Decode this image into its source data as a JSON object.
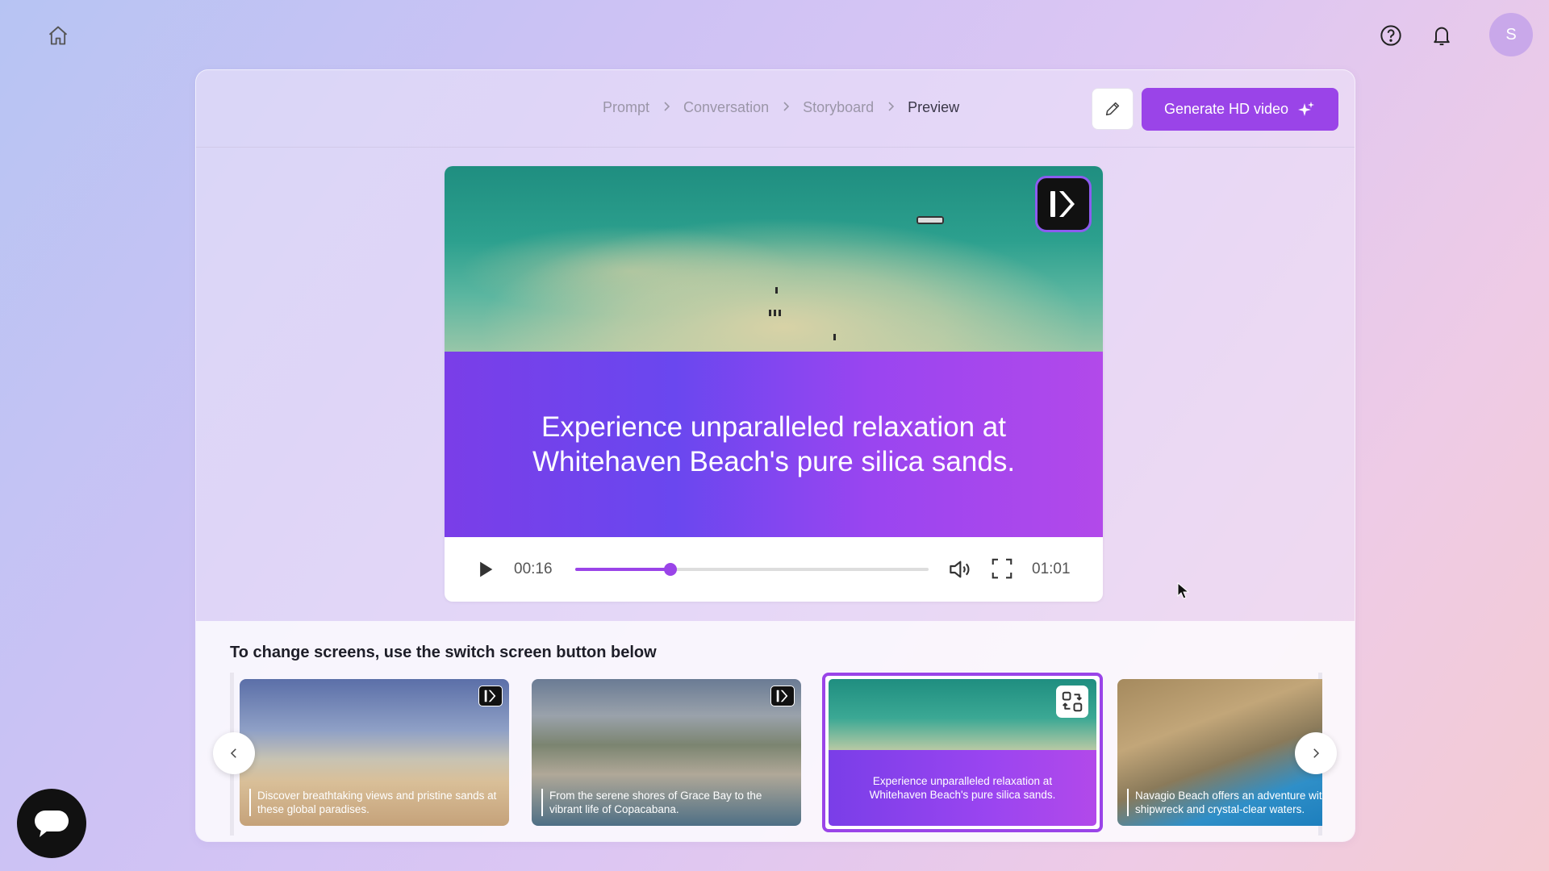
{
  "header": {
    "home_icon": "home-icon",
    "help_icon": "help-circle-icon",
    "bell_icon": "bell-icon",
    "avatar_initial": "S",
    "avatar_color": "#c9a8ea"
  },
  "breadcrumb": {
    "items": [
      {
        "label": "Prompt"
      },
      {
        "label": "Conversation"
      },
      {
        "label": "Storyboard"
      },
      {
        "label": "Preview"
      }
    ]
  },
  "toolbar": {
    "edit_icon": "pencil-icon",
    "generate_label": "Generate HD video",
    "generate_icon": "sparkles-icon",
    "accent_color": "#9a44e8"
  },
  "player": {
    "caption": "Experience unparalleled relaxation at Whitehaven Beach's pure silica sands.",
    "current_time": "00:16",
    "total_time": "01:01",
    "progress": 0.27
  },
  "storyboard": {
    "hint": "To change screens, use the switch screen button below",
    "thumbnails": [
      {
        "caption": "Discover breathtaking views and pristine sands at these global paradises."
      },
      {
        "caption": "From the serene shores of Grace Bay to the vibrant life of Copacabana."
      },
      {
        "caption": "Experience unparalleled relaxation at Whitehaven Beach's pure silica sands.",
        "selected": true
      },
      {
        "caption": "Navagio Beach offers an adventure with its iconic shipwreck and crystal-clear waters."
      }
    ]
  }
}
